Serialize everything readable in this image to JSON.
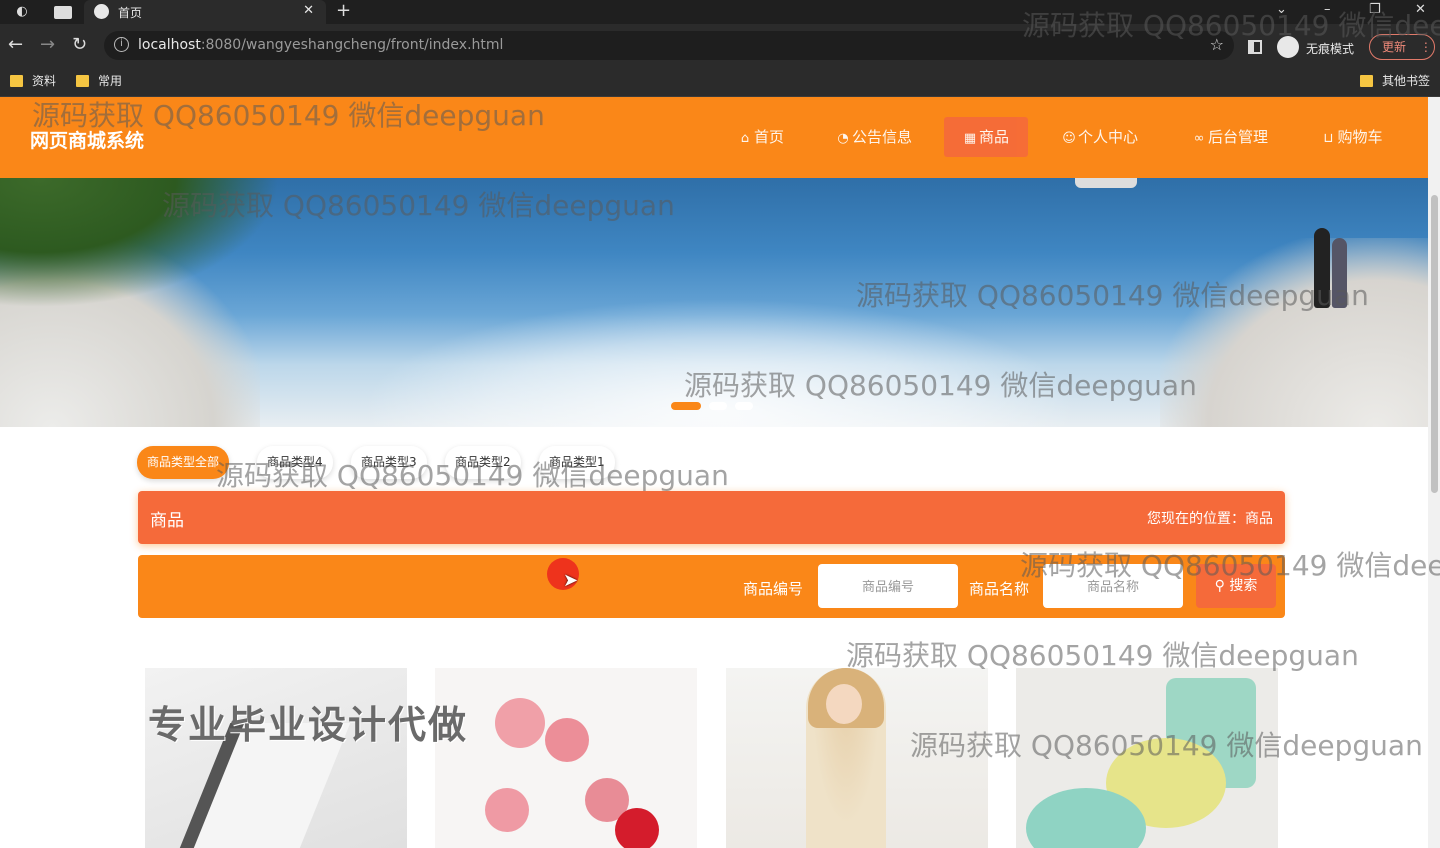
{
  "browser": {
    "tab_title": "首页",
    "url_host": "localhost",
    "url_rest": ":8080/wangyeshangcheng/front/index.html",
    "incognito_label": "无痕模式",
    "update_label": "更新",
    "bookmarks": [
      "资料",
      "常用"
    ],
    "other_bookmarks": "其他书签"
  },
  "site": {
    "title": "网页商城系统",
    "nav": [
      {
        "icon": "home-icon",
        "label": "首页"
      },
      {
        "icon": "notice-icon",
        "label": "公告信息"
      },
      {
        "icon": "goods-icon",
        "label": "商品"
      },
      {
        "icon": "user-icon",
        "label": "个人中心"
      },
      {
        "icon": "link-icon",
        "label": "后台管理"
      },
      {
        "icon": "cart-icon",
        "label": "购物车"
      }
    ],
    "active_nav": "商品"
  },
  "banner": {
    "slides": 3,
    "active_slide": 1
  },
  "categories": [
    "商品类型全部",
    "商品类型4",
    "商品类型3",
    "商品类型2",
    "商品类型1"
  ],
  "breadcrumb": {
    "title": "商品",
    "position_label": "您现在的位置：",
    "position_value": "商品"
  },
  "search": {
    "code_label": "商品编号",
    "code_placeholder": "商品编号",
    "name_label": "商品名称",
    "name_placeholder": "商品名称",
    "button_label": "搜索"
  },
  "promo_text": "专业毕业设计代做",
  "watermark": "源码获取 QQ86050149 微信deepguan",
  "colors": {
    "primary": "#fa8718",
    "accent": "#f56a3a"
  }
}
